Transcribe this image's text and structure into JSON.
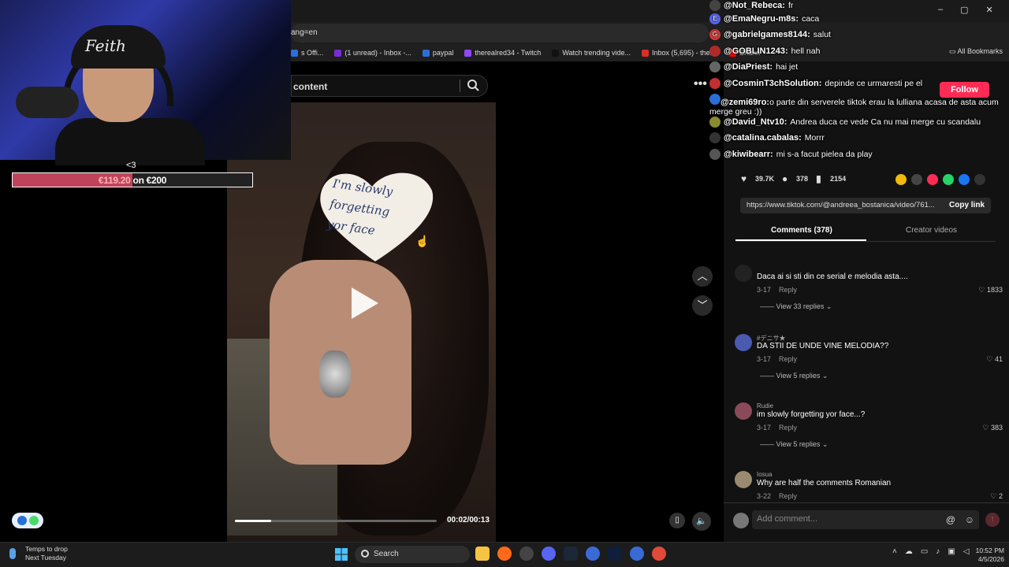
{
  "browser": {
    "address_text": "ang=en",
    "bookmarks": [
      {
        "label": "s Offi...",
        "color": "#2b6fd6"
      },
      {
        "label": "(1 unread) - Inbox -...",
        "color": "#7a2bd6"
      },
      {
        "label": "paypal",
        "color": "#2b6fd6"
      },
      {
        "label": "therealred34 - Twitch",
        "color": "#9146ff"
      },
      {
        "label": "Watch trending vide...",
        "color": "#111111"
      },
      {
        "label": "Inbox (5,695) - ther...",
        "color": "#d93025"
      },
      {
        "label": "Chann",
        "color": "#ff0000"
      }
    ],
    "all_bookmarks": "All Bookmarks"
  },
  "overlay": {
    "heart_label": "<3",
    "goal_amount": "€119.20",
    "goal_suffix": " on €200",
    "goal_progress": 0.5
  },
  "webcam": {
    "hat_text": "Feith"
  },
  "tiktok": {
    "search_text": "content",
    "note_lines": [
      "I'm slowly",
      "forgetting",
      "yor face"
    ],
    "time": "00:02/00:13",
    "progress": 0.18,
    "follow": "Follow",
    "stats": {
      "likes": "39.7K",
      "comments": "378",
      "saves": "2154"
    },
    "link": "https://www.tiktok.com/@andreea_bostanica/video/761...",
    "copy_link": "Copy link",
    "tab_comments": "Comments (378)",
    "tab_creator": "Creator videos",
    "comments": [
      {
        "name": "",
        "text": "Daca ai si sti din ce serial e melodia asta....",
        "date": "3-17",
        "reply": "Reply",
        "likes": "1833",
        "replies": "View 33 replies",
        "avatar": "#222222"
      },
      {
        "name": "#デニサ★",
        "text": "DA STII DE UNDE VINE MELODIA??",
        "date": "3-17",
        "reply": "Reply",
        "likes": "41",
        "replies": "View 5 replies",
        "avatar": "#4a5ab0"
      },
      {
        "name": "Rudie",
        "text": "im slowly forgetting yor face...?",
        "date": "3-17",
        "reply": "Reply",
        "likes": "383",
        "replies": "View 5 replies",
        "avatar": "#8a4a5a"
      },
      {
        "name": "Iosua",
        "text": "Why are half the comments Romanian",
        "date": "3-22",
        "reply": "Reply",
        "likes": "2",
        "replies": "",
        "avatar": "#9a8a70"
      }
    ],
    "add_comment": "Add comment..."
  },
  "chat": [
    {
      "user": "@Not_Rebeca:",
      "msg": "fr",
      "badge": "#444444",
      "badge_text": ""
    },
    {
      "user": "@EmaNegru-m8s:",
      "msg": "caca",
      "badge": "#5865f2",
      "badge_text": "E"
    },
    {
      "user": "@gabrielgames8144:",
      "msg": "salut",
      "badge": "#d03a3a",
      "badge_text": "G"
    },
    {
      "user": "@GOBLIN1243:",
      "msg": "hell nah",
      "badge": "#b02a2a",
      "badge_text": ""
    },
    {
      "user": "@DiaPriest:",
      "msg": "hai jet",
      "badge": "#666666",
      "badge_text": ""
    },
    {
      "user": "@CosminT3chSolution:",
      "msg": "depinde ce urmaresti pe el",
      "badge": "#c03030",
      "badge_text": ""
    },
    {
      "user": "@zemi69ro:",
      "msg": "o parte din serverele tiktok erau la lulliana acasa de asta acum merge greu :))",
      "badge": "#2b6fd6",
      "badge_text": ""
    },
    {
      "user": "@David_Ntv10:",
      "msg": "Andrea duca ce vede Ca nu mai merge cu scandalu",
      "badge": "#8a8a30",
      "badge_text": ""
    },
    {
      "user": "@catalina.cabalas:",
      "msg": "Morrr",
      "badge": "#333333",
      "badge_text": ""
    },
    {
      "user": "@kiwibearr:",
      "msg": "mi s-a facut pielea da play",
      "badge": "#555555",
      "badge_text": ""
    }
  ],
  "taskbar": {
    "weather_title": "Temps to drop",
    "weather_sub": "Next Tuesday",
    "search": "Search",
    "time": "10:52 PM",
    "date": "4/5/2026"
  }
}
